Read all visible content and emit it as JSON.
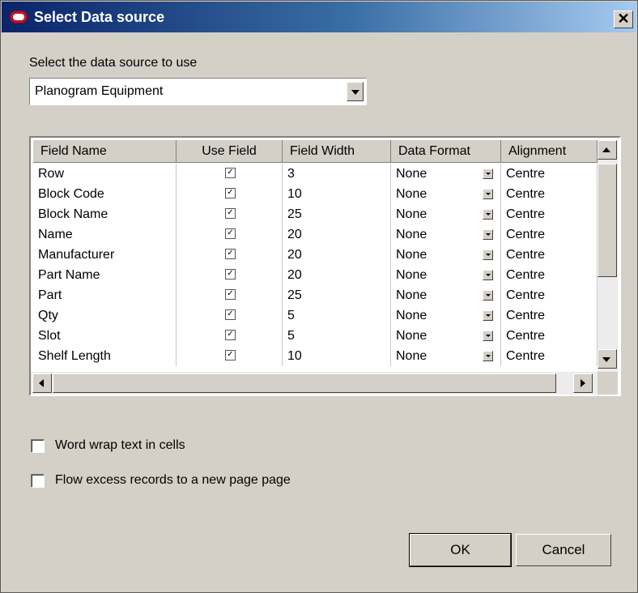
{
  "window": {
    "title": "Select Data source",
    "close_glyph": "✕"
  },
  "source": {
    "label": "Select the data source to use",
    "selected": "Planogram Equipment"
  },
  "grid": {
    "columns": [
      "Field Name",
      "Use Field",
      "Field Width",
      "Data Format",
      "Alignment"
    ],
    "rows": [
      {
        "name": "Row",
        "use": "✓",
        "width": "3",
        "format": "None",
        "align": "Centre"
      },
      {
        "name": "Block Code",
        "use": "✓",
        "width": "10",
        "format": "None",
        "align": "Centre"
      },
      {
        "name": "Block Name",
        "use": "✓",
        "width": "25",
        "format": "None",
        "align": "Centre"
      },
      {
        "name": "Name",
        "use": "✓",
        "width": "20",
        "format": "None",
        "align": "Centre"
      },
      {
        "name": "Manufacturer",
        "use": "✓",
        "width": "20",
        "format": "None",
        "align": "Centre"
      },
      {
        "name": "Part Name",
        "use": "✓",
        "width": "20",
        "format": "None",
        "align": "Centre"
      },
      {
        "name": "Part",
        "use": "✓",
        "width": "25",
        "format": "None",
        "align": "Centre"
      },
      {
        "name": "Qty",
        "use": "✓",
        "width": "5",
        "format": "None",
        "align": "Centre"
      },
      {
        "name": "Slot",
        "use": "✓",
        "width": "5",
        "format": "None",
        "align": "Centre"
      },
      {
        "name": "Shelf Length",
        "use": "✓",
        "width": "10",
        "format": "None",
        "align": "Centre"
      }
    ]
  },
  "options": {
    "word_wrap_label": "Word wrap text in cells",
    "word_wrap_checked": false,
    "flow_label": "Flow excess records to a new page page",
    "flow_checked": false
  },
  "buttons": {
    "ok": "OK",
    "cancel": "Cancel"
  },
  "colors": {
    "titlebar_start": "#0a246a",
    "titlebar_end": "#a6caf0",
    "face": "#d4d0c8",
    "icon_red": "#c0142a"
  },
  "icons": [
    "oracle-logo-icon",
    "close-icon",
    "dropdown-arrow-icon",
    "scroll-up-icon",
    "scroll-down-icon",
    "scroll-left-icon",
    "scroll-right-icon",
    "checkmark-icon"
  ]
}
